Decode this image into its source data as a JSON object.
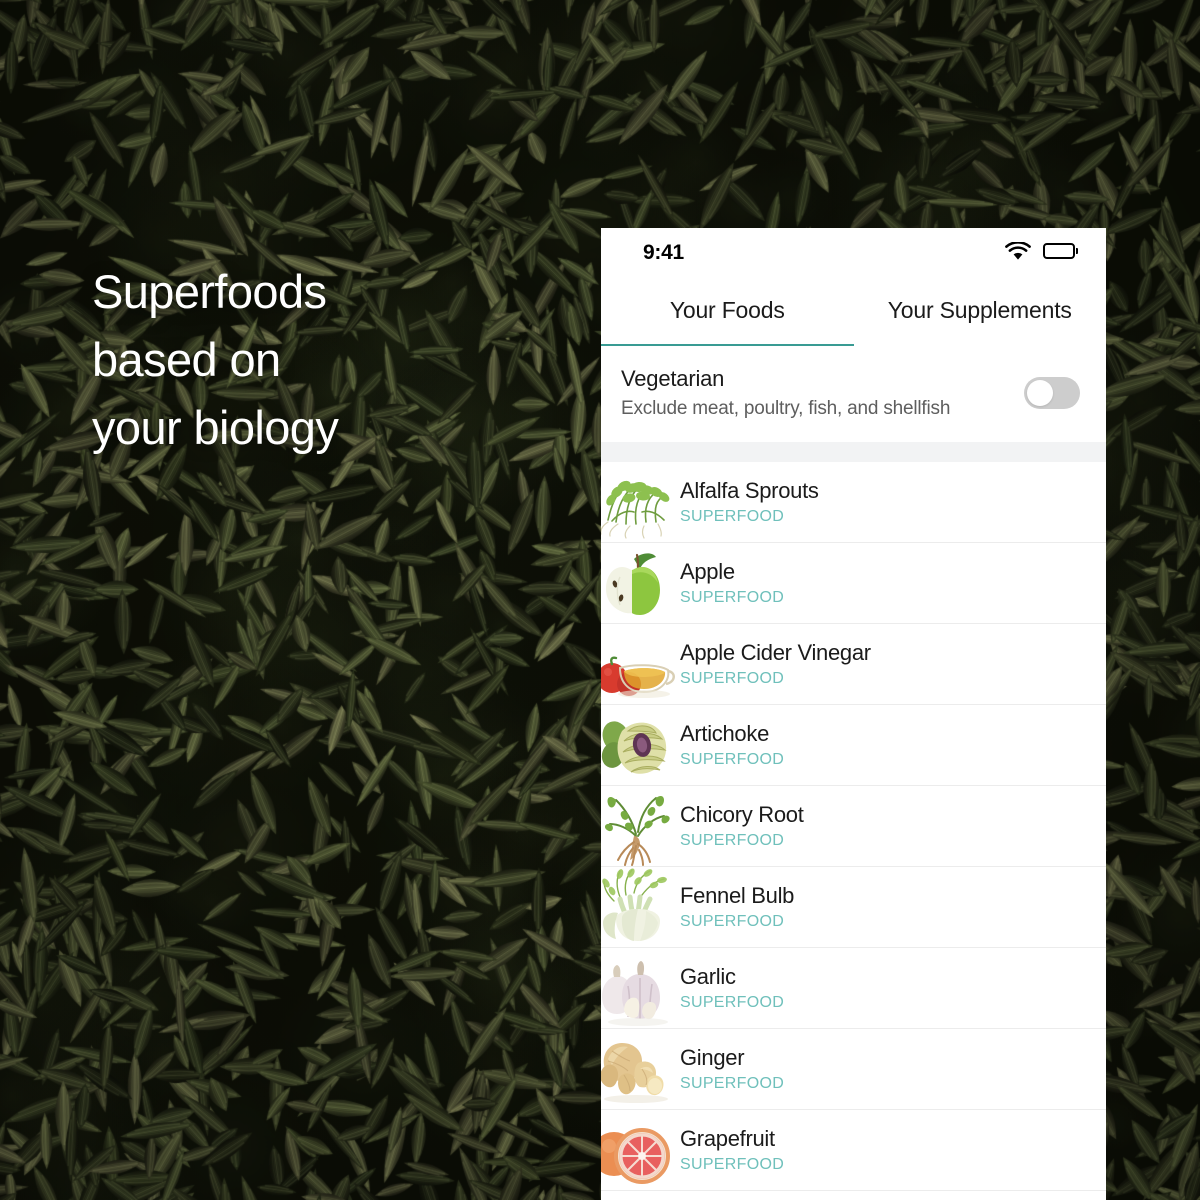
{
  "headline": {
    "lines": [
      "Superfoods",
      "based on",
      "your biology"
    ]
  },
  "colors": {
    "teal_tag": "#6fc0bb",
    "teal_underline": "#399b93",
    "text_primary": "#1b1b1b",
    "text_secondary": "#5e5e5e",
    "band": "#f2f3f4",
    "switch_off": "#cdcdcd"
  },
  "phone": {
    "statusbar": {
      "time": "9:41",
      "wifi_icon": "wifi-icon",
      "battery_icon": "battery-full-icon"
    },
    "tabs": [
      {
        "label": "Your Foods",
        "active": true
      },
      {
        "label": "Your Supplements",
        "active": false
      }
    ],
    "preference": {
      "title": "Vegetarian",
      "subtitle": "Exclude meat, poultry, fish, and shellfish",
      "toggle_on": false
    },
    "food_list": [
      {
        "name": "Alfalfa Sprouts",
        "tag": "SUPERFOOD",
        "thumb": "alfalfa-sprouts-thumb"
      },
      {
        "name": "Apple",
        "tag": "SUPERFOOD",
        "thumb": "apple-thumb"
      },
      {
        "name": "Apple Cider Vinegar",
        "tag": "SUPERFOOD",
        "thumb": "apple-cider-vinegar-thumb"
      },
      {
        "name": "Artichoke",
        "tag": "SUPERFOOD",
        "thumb": "artichoke-thumb"
      },
      {
        "name": "Chicory Root",
        "tag": "SUPERFOOD",
        "thumb": "chicory-root-thumb"
      },
      {
        "name": "Fennel Bulb",
        "tag": "SUPERFOOD",
        "thumb": "fennel-bulb-thumb"
      },
      {
        "name": "Garlic",
        "tag": "SUPERFOOD",
        "thumb": "garlic-thumb"
      },
      {
        "name": "Ginger",
        "tag": "SUPERFOOD",
        "thumb": "ginger-thumb"
      },
      {
        "name": "Grapefruit",
        "tag": "SUPERFOOD",
        "thumb": "grapefruit-thumb"
      }
    ]
  }
}
